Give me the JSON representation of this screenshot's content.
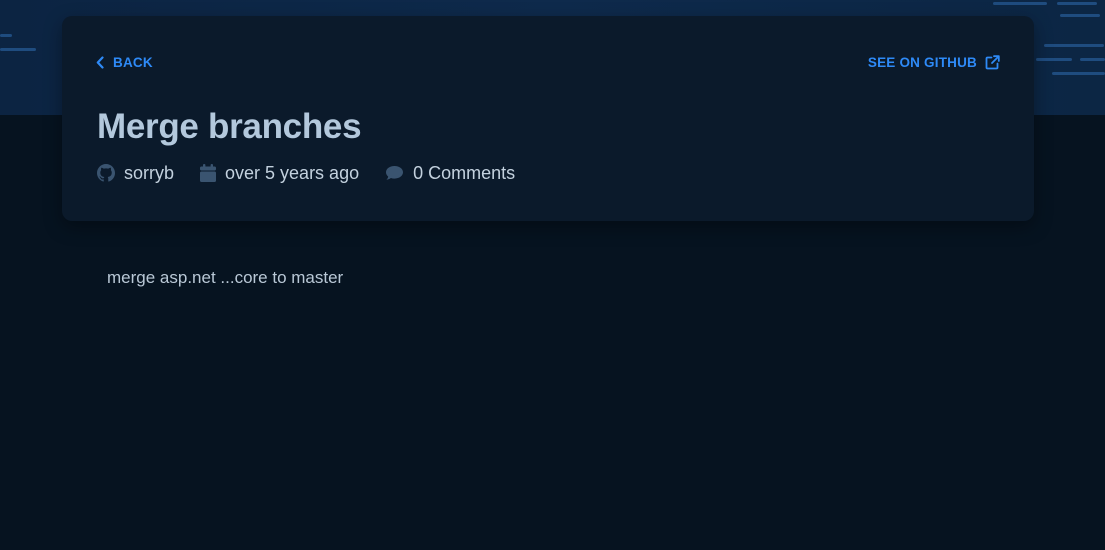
{
  "nav": {
    "back_label": "BACK",
    "github_label": "SEE ON GITHUB"
  },
  "post": {
    "title": "Merge branches",
    "author": "sorryb",
    "date": "over 5 years ago",
    "comments": "0 Comments",
    "body": "merge asp.net ...core to master"
  },
  "icons": {
    "back": "chevron-left-icon",
    "external": "external-link-icon",
    "author": "github-icon",
    "date": "calendar-icon",
    "comments": "comment-icon"
  },
  "colors": {
    "page_background": "#061320",
    "hero_background": "#0e2a4c",
    "card_background": "#0b1a2b",
    "accent_link": "#2e8af7",
    "title_text": "#b3c8dc",
    "meta_icon": "#3a5470"
  }
}
